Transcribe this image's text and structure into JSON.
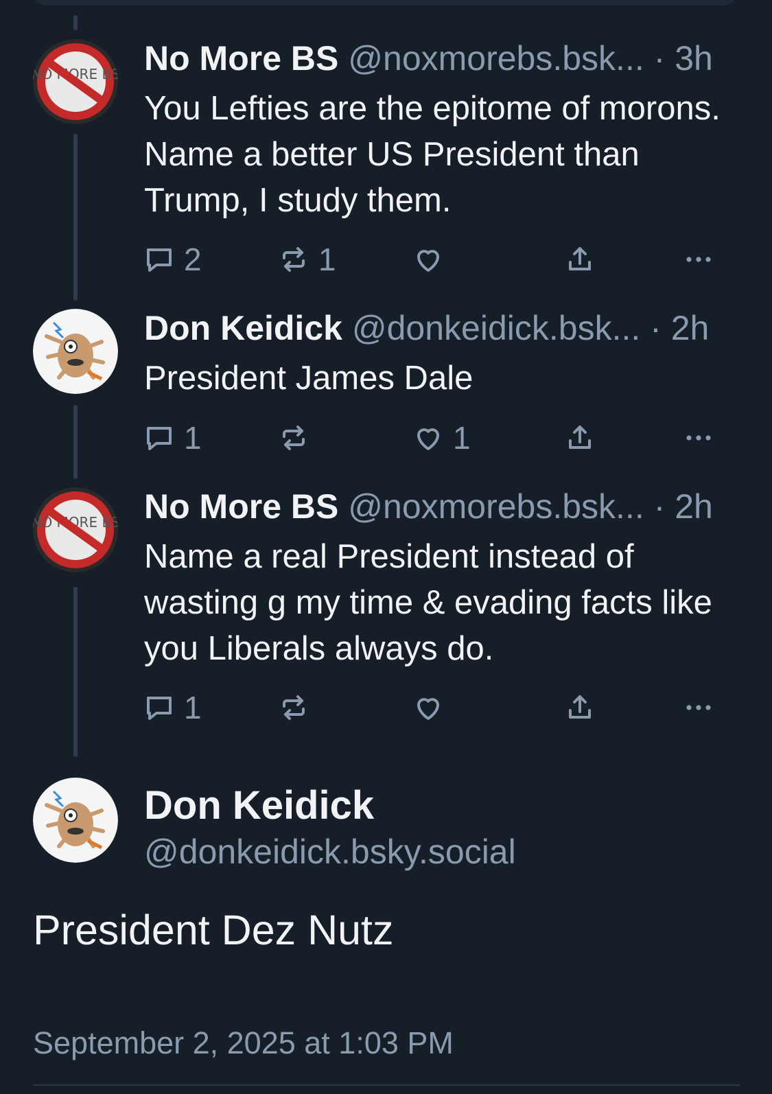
{
  "posts": [
    {
      "name": "No More BS",
      "handle": "@noxmorebs.bsk...",
      "time": "· 3h",
      "text": "You Lefties are the epitome of morons. Name a better US President than Trump, I study them.",
      "replies": "2",
      "reposts": "1",
      "likes": "",
      "avatar_icon": "no-bs-avatar-icon",
      "avatar_text": "NO MORE BS"
    },
    {
      "name": "Don Keidick",
      "handle": "@donkeidick.bsk...",
      "time": "· 2h",
      "text": "President James Dale",
      "replies": "1",
      "reposts": "",
      "likes": "1",
      "avatar_icon": "cartoon-creature-avatar-icon"
    },
    {
      "name": "No More BS",
      "handle": "@noxmorebs.bsk...",
      "time": "· 2h",
      "text": "Name a real President instead of wasting g my time & evading facts like you Liberals always do.",
      "replies": "1",
      "reposts": "",
      "likes": "",
      "avatar_icon": "no-bs-avatar-icon",
      "avatar_text": "NO MORE BS"
    }
  ],
  "main_post": {
    "name": "Don Keidick",
    "handle": "@donkeidick.bsky.social",
    "text": "President Dez Nutz",
    "date": "September 2, 2025 at 1:03 PM",
    "avatar_icon": "cartoon-creature-avatar-icon"
  },
  "colors": {
    "background": "#161e27",
    "text": "#f1f3f5",
    "muted": "#8a9bb0",
    "thread_line": "#2e3c4d"
  }
}
